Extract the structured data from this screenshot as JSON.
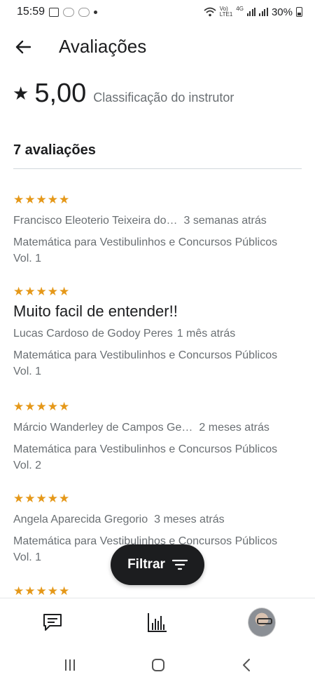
{
  "status_bar": {
    "time": "15:59",
    "network_label_1": "Vo)",
    "network_label_2": "LTE1",
    "network_label_3": "4G",
    "battery": "30%"
  },
  "header": {
    "title": "Avaliações",
    "back_icon": "arrow-left-icon"
  },
  "summary": {
    "rating": "5,00",
    "caption": "Classificação do instrutor",
    "star_icon": "star-icon"
  },
  "reviews_count_label": "7 avaliações",
  "star_color": "#e59819",
  "reviews": [
    {
      "stars": "★★★★★",
      "rating": 5,
      "text": "",
      "author": "Francisco Eleoterio Teixeira do…",
      "time": "3 semanas atrás",
      "course": "Matemática para Vestibulinhos e Concursos Públicos Vol. 1"
    },
    {
      "stars": "★★★★★",
      "rating": 5,
      "text": "Muito facil de entender!!",
      "author": "Lucas Cardoso de Godoy Peres",
      "time": "1 mês atrás",
      "course": "Matemática para Vestibulinhos e Concursos Públicos Vol. 1"
    },
    {
      "stars": "★★★★★",
      "rating": 5,
      "text": "",
      "author": "Márcio Wanderley de Campos Ge…",
      "time": "2 meses atrás",
      "course": "Matemática para Vestibulinhos e Concursos Públicos Vol. 2"
    },
    {
      "stars": "★★★★★",
      "rating": 5,
      "text": "",
      "author": "Angela Aparecida Gregorio",
      "time": "3 meses atrás",
      "course": "Matemática para Vestibulinhos e Concursos Públicos Vol. 1"
    },
    {
      "stars": "★★★★★",
      "rating": 5,
      "text": "",
      "author": "",
      "time": "",
      "course": ""
    }
  ],
  "filter_button": {
    "label": "Filtrar",
    "icon": "filter-icon"
  },
  "bottom_nav": {
    "items": [
      "chat-icon",
      "bar-chart-icon",
      "avatar"
    ]
  },
  "system_nav": {
    "items": [
      "recents-icon",
      "home-icon",
      "back-icon"
    ]
  }
}
